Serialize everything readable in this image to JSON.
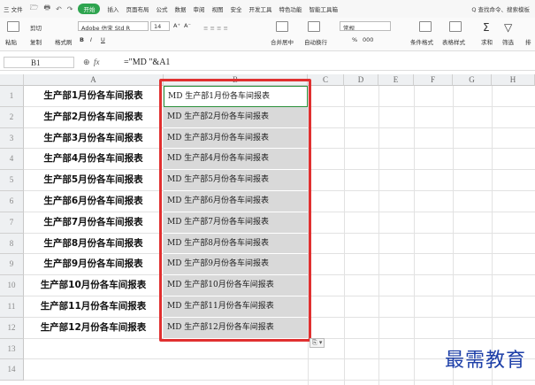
{
  "menubar": {
    "file": "三 文件",
    "quick_icons": [
      "🗁",
      "🖶",
      "↶",
      "↷"
    ],
    "active_tab": "开始",
    "tabs": [
      "插入",
      "页面布局",
      "公式",
      "数据",
      "审阅",
      "视图",
      "安全",
      "开发工具",
      "特色功能",
      "智能工具箱"
    ],
    "search": "Q 查找命令、搜索模板"
  },
  "ribbon": {
    "paste": "粘贴",
    "cut": "剪切",
    "copy": "复制",
    "format_painter": "格式刷",
    "font_name": "Adobe 仿宋 Std R",
    "font_size": "14",
    "font_grow": "A⁺",
    "font_shrink": "A⁻",
    "bold": "B",
    "italic": "I",
    "underline": "U",
    "merge_center": "合并居中",
    "wrap_text": "自动换行",
    "number_format": "常规",
    "percent": "%",
    "thousands": "000",
    "cond_format": "条件格式",
    "table_style": "表格样式",
    "sum": "求和",
    "filter": "筛选",
    "sort": "排"
  },
  "formula_bar": {
    "name_box": "B1",
    "fx": "fx",
    "formula": "=\"MD \"&A1"
  },
  "columns": [
    "A",
    "B",
    "C",
    "D",
    "E",
    "F",
    "G",
    "H"
  ],
  "rows": [
    "1",
    "2",
    "3",
    "4",
    "5",
    "6",
    "7",
    "8",
    "9",
    "10",
    "11",
    "12",
    "13",
    "14"
  ],
  "colA": [
    "生产部1月份各车间报表",
    "生产部2月份各车间报表",
    "生产部3月份各车间报表",
    "生产部4月份各车间报表",
    "生产部5月份各车间报表",
    "生产部6月份各车间报表",
    "生产部7月份各车间报表",
    "生产部8月份各车间报表",
    "生产部9月份各车间报表",
    "生产部10月份各车间报表",
    "生产部11月份各车间报表",
    "生产部12月份各车间报表"
  ],
  "colB": [
    "MD 生产部1月份各车间报表",
    "MD 生产部2月份各车间报表",
    "MD 生产部3月份各车间报表",
    "MD 生产部4月份各车间报表",
    "MD 生产部5月份各车间报表",
    "MD 生产部6月份各车间报表",
    "MD 生产部7月份各车间报表",
    "MD 生产部8月份各车间报表",
    "MD 生产部9月份各车间报表",
    "MD 生产部10月份各车间报表",
    "MD 生产部11月份各车间报表",
    "MD 生产部12月份各车间报表"
  ],
  "paste_options": "⎘ ▾",
  "watermark": "最需教育",
  "colors": {
    "accent": "#2ea44f",
    "highlight": "#e03030",
    "watermark": "#1d3fa8"
  }
}
